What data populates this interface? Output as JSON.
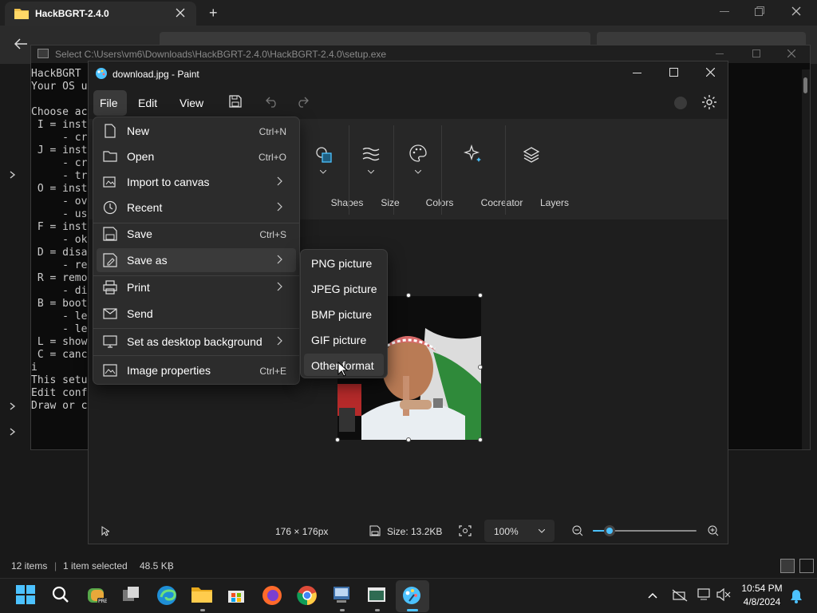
{
  "explorer": {
    "tab_title": "HackBGRT-2.4.0",
    "new_tab": "+",
    "status": {
      "items": "12 items",
      "selected": "1 item selected",
      "size": "48.5 KB"
    }
  },
  "console": {
    "title": "Select C:\\Users\\vm6\\Downloads\\HackBGRT-2.4.0\\HackBGRT-2.4.0\\setup.exe",
    "lines": "HackBGRT\nYour OS u\n\nChoose ac\n I = inst\n     - cr\n J = inst\n     - cr\n     - tr\n O = inst\n     - ov\n     - us\n F = inst\n     - ok\n D = disa\n     - re\n R = remo\n     - di\n B = boot\n     - le\n     - le\n L = show\n C = canc\ni\nThis setu\nEdit conf\nDraw or c"
  },
  "paint": {
    "title": "download.jpg - Paint",
    "menus": [
      "File",
      "Edit",
      "View"
    ],
    "ribbon": [
      "Shapes",
      "Size",
      "Colors",
      "Cocreator",
      "Layers"
    ],
    "status": {
      "dimensions": "176 × 176px",
      "size": "Size: 13.2KB",
      "zoom": "100%",
      "zoom_level": 0.1
    }
  },
  "file_menu": {
    "items": [
      {
        "label": "New",
        "shortcut": "Ctrl+N",
        "icon": "new-page-icon"
      },
      {
        "label": "Open",
        "shortcut": "Ctrl+O",
        "icon": "folder-icon"
      },
      {
        "label": "Import to canvas",
        "shortcut": "",
        "icon": "import-icon",
        "submenu": true
      },
      {
        "label": "Recent",
        "shortcut": "",
        "icon": "clock-icon",
        "submenu": true
      },
      {
        "label": "Save",
        "shortcut": "Ctrl+S",
        "icon": "save-icon"
      },
      {
        "label": "Save as",
        "shortcut": "",
        "icon": "save-as-icon",
        "submenu": true
      },
      {
        "label": "Print",
        "shortcut": "",
        "icon": "printer-icon",
        "submenu": true
      },
      {
        "label": "Send",
        "shortcut": "",
        "icon": "send-icon"
      },
      {
        "label": "Set as desktop background",
        "shortcut": "",
        "icon": "desktop-icon",
        "submenu": true
      },
      {
        "label": "Image properties",
        "shortcut": "Ctrl+E",
        "icon": "image-properties-icon"
      }
    ]
  },
  "save_as_menu": {
    "items": [
      "PNG picture",
      "JPEG picture",
      "BMP picture",
      "GIF picture",
      "Other format"
    ]
  },
  "taskbar": {
    "time": "10:54 PM",
    "date": "4/8/2024"
  },
  "colors": {
    "accent": "#4cc2ff",
    "menu_bg": "#2c2c2c",
    "hover": "#3a3a3a"
  }
}
